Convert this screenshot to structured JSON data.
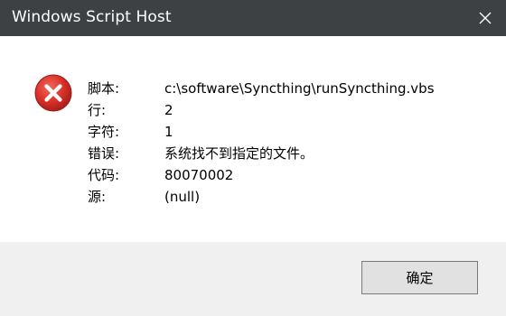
{
  "window": {
    "title": "Windows Script Host",
    "icon": "error-icon"
  },
  "fields": [
    {
      "label": "脚本:",
      "value": "c:\\software\\Syncthing\\runSyncthing.vbs"
    },
    {
      "label": "行:",
      "value": "2"
    },
    {
      "label": "字符:",
      "value": "1"
    },
    {
      "label": "错误:",
      "value": "系统找不到指定的文件。"
    },
    {
      "label": "代码:",
      "value": "80070002"
    },
    {
      "label": "源:",
      "value": "(null)"
    }
  ],
  "buttons": {
    "ok_label": "确定"
  },
  "colors": {
    "titlebar": "#3e4144",
    "error_red": "#d9312a",
    "footer": "#f0f0f0"
  }
}
